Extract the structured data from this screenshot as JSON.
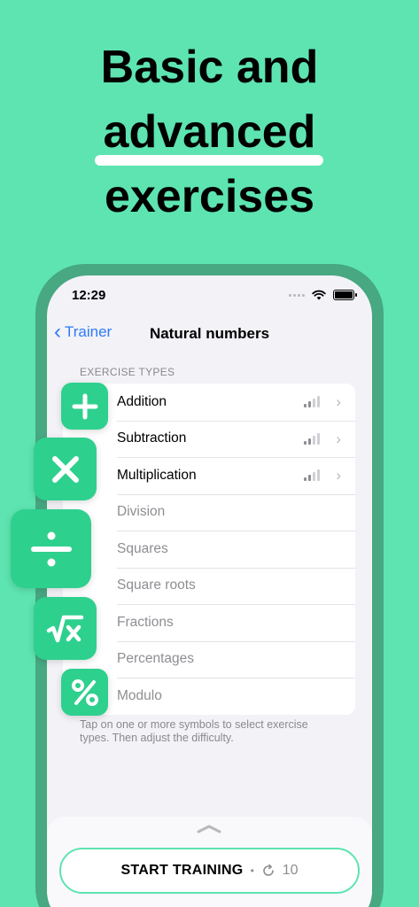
{
  "headline": {
    "line1": "Basic and",
    "line2": "advanced",
    "line3": "exercises"
  },
  "status_bar": {
    "time": "12:29"
  },
  "nav": {
    "back_label": "Trainer",
    "title": "Natural numbers"
  },
  "section": {
    "header": "EXERCISE TYPES",
    "footnote": "Tap on one or more symbols to select exercise types. Then adjust the difficulty."
  },
  "exercises": [
    {
      "label": "Addition",
      "enabled": true,
      "difficulty_level": 2,
      "difficulty_max": 4
    },
    {
      "label": "Subtraction",
      "enabled": true,
      "difficulty_level": 2,
      "difficulty_max": 4
    },
    {
      "label": "Multiplication",
      "enabled": true,
      "difficulty_level": 2,
      "difficulty_max": 4
    },
    {
      "label": "Division",
      "enabled": false
    },
    {
      "label": "Squares",
      "enabled": false
    },
    {
      "label": "Square roots",
      "enabled": false
    },
    {
      "label": "Fractions",
      "enabled": false
    },
    {
      "label": "Percentages",
      "enabled": false
    },
    {
      "label": "Modulo",
      "enabled": false
    }
  ],
  "icons": {
    "plus": "plus-icon",
    "times": "multiply-icon",
    "divide": "divide-icon",
    "sqrt": "square-root-icon",
    "percent": "percent-icon"
  },
  "start": {
    "label": "START TRAINING",
    "separator": "•",
    "count": "10"
  },
  "colors": {
    "background": "#5de4b1",
    "accent": "#2ed08e",
    "link": "#2f7bf6"
  }
}
